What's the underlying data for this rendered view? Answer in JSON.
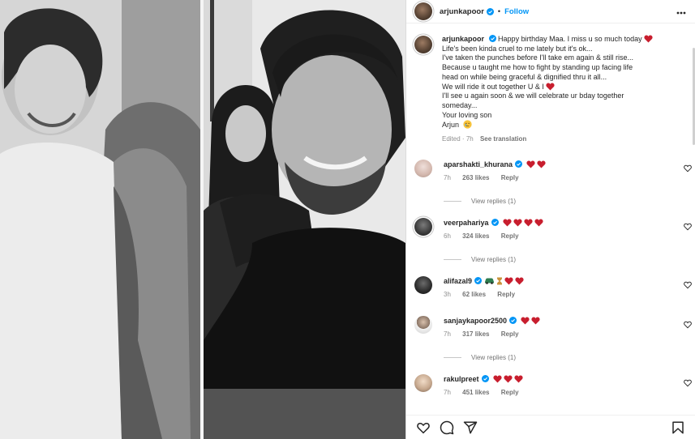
{
  "header": {
    "username": "arjunkapoor",
    "separator": "•",
    "follow_label": "Follow",
    "more_icon": "more-horizontal-icon"
  },
  "caption": {
    "username": "arjunkapoor",
    "lines": [
      "Happy birthday Maa. I miss u so much today",
      "Life's been kinda cruel to me lately but it's ok...",
      "I've taken the punches before I'll take em again & still rise...",
      "Because u taught me how to fight by standing up facing life",
      "head on while being graceful & dignified thru it all...",
      "We will ride it out together U & I",
      "I'll see u again soon & we will celebrate ur bday together",
      "someday...",
      "Your loving son",
      "Arjun"
    ],
    "edited": "Edited",
    "time": "7h",
    "see_translation": "See translation"
  },
  "comments": [
    {
      "username": "aparshakti_khurana",
      "verified": true,
      "hearts": 2,
      "time": "7h",
      "likes": "263 likes",
      "reply": "Reply",
      "view_replies": "View replies (1)",
      "avatar_color": "#d8c3bd"
    },
    {
      "username": "veerpahariya",
      "verified": true,
      "hearts": 4,
      "time": "6h",
      "likes": "324 likes",
      "reply": "Reply",
      "view_replies": "View replies (1)",
      "avatar_color": "#3a3a3a"
    },
    {
      "username": "alifazal9",
      "verified": true,
      "hearts": 2,
      "time": "3h",
      "likes": "62 likes",
      "reply": "Reply",
      "view_replies": "",
      "avatar_color": "#2b2b2b"
    },
    {
      "username": "sanjaykapoor2500",
      "verified": true,
      "hearts": 2,
      "time": "7h",
      "likes": "317 likes",
      "reply": "Reply",
      "view_replies": "View replies (1)",
      "avatar_color": "#6d6d6d"
    },
    {
      "username": "rakulpreet",
      "verified": true,
      "hearts": 3,
      "time": "7h",
      "likes": "451 likes",
      "reply": "Reply",
      "view_replies": "",
      "avatar_color": "#c7a98f"
    }
  ],
  "actions": {
    "like_icon": "heart-outline-icon",
    "comment_icon": "comment-icon",
    "share_icon": "share-icon",
    "save_icon": "bookmark-icon"
  },
  "colors": {
    "accent": "#0095f6",
    "heart": "#c81e2e",
    "verified": "#0095f6",
    "muted": "#8e8e8e"
  }
}
